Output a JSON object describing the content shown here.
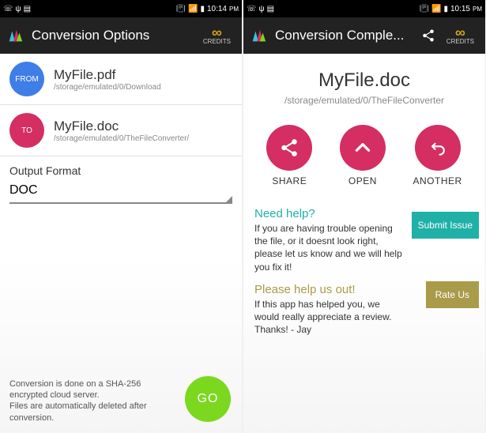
{
  "statusbar": {
    "time_left": "10:14",
    "time_right": "10:15",
    "time_suffix": "PM"
  },
  "screen1": {
    "title": "Conversion Options",
    "credits_label": "CREDITS",
    "from_badge": "FROM",
    "to_badge": "TO",
    "from_file": "MyFile.pdf",
    "from_path": "/storage/emulated/0/Download",
    "to_file": "MyFile.doc",
    "to_path": "/storage/emulated/0/TheFileConverter/",
    "output_format_label": "Output Format",
    "output_format_value": "DOC",
    "footer_note": "Conversion is done on a SHA-256 encrypted cloud server.\nFiles are automatically deleted after conversion.",
    "go_label": "GO"
  },
  "screen2": {
    "title": "Conversion Comple...",
    "credits_label": "CREDITS",
    "result_filename": "MyFile.doc",
    "result_path": "/storage/emulated/0/TheFileConverter",
    "actions": {
      "share": "SHARE",
      "open": "OPEN",
      "another": "ANOTHER"
    },
    "help1_title": "Need help?",
    "help1_text": "If you are having trouble opening the file, or it doesnt look right, please let us know and we will help you fix it!",
    "help1_btn": "Submit Issue",
    "help2_title": "Please help us out!",
    "help2_text": "If this app has helped you, we would really appreciate a review. Thanks! - Jay",
    "help2_btn": "Rate Us"
  }
}
